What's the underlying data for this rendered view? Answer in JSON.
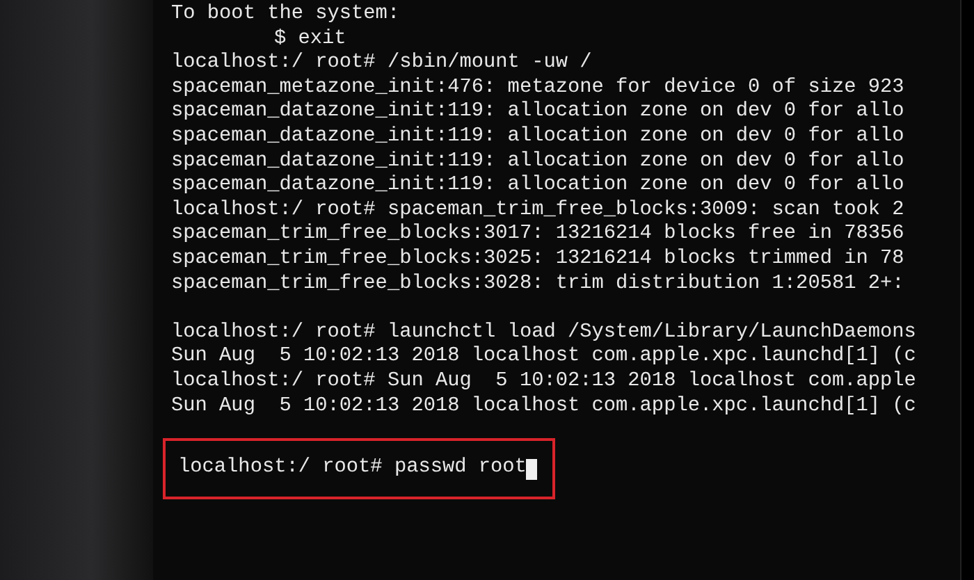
{
  "terminal": {
    "lines": [
      {
        "kind": "line",
        "text": "To boot the system:"
      },
      {
        "kind": "indented",
        "text": "$ exit"
      },
      {
        "kind": "line",
        "text": "localhost:/ root# /sbin/mount -uw /"
      },
      {
        "kind": "line",
        "text": "spaceman_metazone_init:476: metazone for device 0 of size 923"
      },
      {
        "kind": "line",
        "text": "spaceman_datazone_init:119: allocation zone on dev 0 for allo"
      },
      {
        "kind": "line",
        "text": "spaceman_datazone_init:119: allocation zone on dev 0 for allo"
      },
      {
        "kind": "line",
        "text": "spaceman_datazone_init:119: allocation zone on dev 0 for allo"
      },
      {
        "kind": "line",
        "text": "spaceman_datazone_init:119: allocation zone on dev 0 for allo"
      },
      {
        "kind": "line",
        "text": "localhost:/ root# spaceman_trim_free_blocks:3009: scan took 2"
      },
      {
        "kind": "line",
        "text": "spaceman_trim_free_blocks:3017: 13216214 blocks free in 78356"
      },
      {
        "kind": "line",
        "text": "spaceman_trim_free_blocks:3025: 13216214 blocks trimmed in 78"
      },
      {
        "kind": "line",
        "text": "spaceman_trim_free_blocks:3028: trim distribution 1:20581 2+:"
      },
      {
        "kind": "blank"
      },
      {
        "kind": "line",
        "text": "localhost:/ root# launchctl load /System/Library/LaunchDaemons"
      },
      {
        "kind": "line",
        "text": "Sun Aug  5 10:02:13 2018 localhost com.apple.xpc.launchd[1] (c"
      },
      {
        "kind": "line",
        "text": "localhost:/ root# Sun Aug  5 10:02:13 2018 localhost com.apple"
      },
      {
        "kind": "line",
        "text": "Sun Aug  5 10:02:13 2018 localhost com.apple.xpc.launchd[1] (c"
      }
    ],
    "highlighted_command": {
      "text": "localhost:/ root# passwd root",
      "cursor": true
    }
  }
}
